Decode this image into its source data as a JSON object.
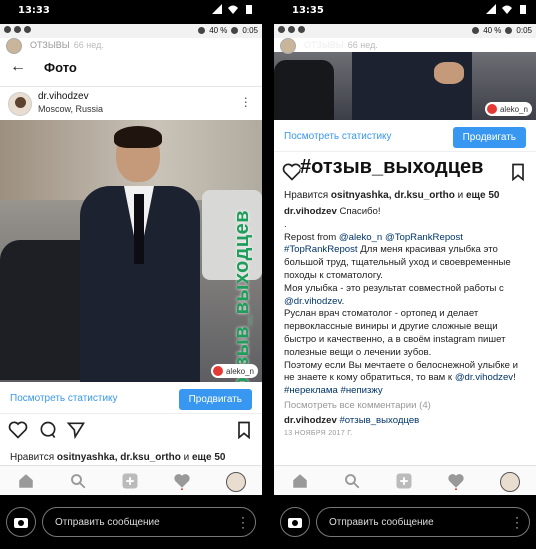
{
  "left": {
    "outer_time": "13:33",
    "inner_status": {
      "battery": "40 %",
      "time": "0:05"
    },
    "story": {
      "name": "ОТЗЫВЫ",
      "time": "66 нед."
    },
    "topbar_title": "Фото",
    "post": {
      "username": "dr.vihodzev",
      "location": "Moscow, Russia",
      "overlay_hashtag": "#отзыв_выходцев",
      "watermark": "aleko_n"
    },
    "stats_link": "Посмотреть статистику",
    "promote_button": "Продвигать",
    "likes": {
      "prefix": "Нравится ",
      "users": "ositnyashka, dr.ksu_ortho",
      "mid": " и ",
      "more": "еще 50"
    },
    "message_placeholder": "Отправить сообщение"
  },
  "right": {
    "outer_time": "13:35",
    "inner_status": {
      "battery": "40 %",
      "time": "0:05"
    },
    "story": {
      "name": "ОТЗЫВЫ",
      "time": "66 нед."
    },
    "watermark": "aleko_n",
    "stats_link": "Посмотреть статистику",
    "promote_button": "Продвигать",
    "caption_hashtag": "#отзыв_выходцев",
    "likes": {
      "prefix": "Нравится ",
      "users": "ositnyashka, dr.ksu_ortho",
      "mid": " и ",
      "more": "еще 50"
    },
    "caption": {
      "author": "dr.vihodzev",
      "thanks": " Спасибо! ",
      "dot": ".",
      "repost_prefix": "Repost from ",
      "repost_user1": "@aleko_n",
      "repost_user2": "@TopRankRepost",
      "repost_tag": "#TopRankRepost",
      "text1": " Для меня красивая улыбка это большой труд, тщательный уход и своевременные походы к стоматологу.",
      "text2": "Моя улыбка - это результат совместной работы с ",
      "mention": "@dr.vihodzev",
      "text2_end": ".",
      "text3": "Руслан врач стоматолог - ортопед и делает первоклассные виниры и другие сложные вещи быстро и качественно, а в своём instagram пишет полезные вещи о лечении зубов.",
      "text4": "Поэтому если Вы мечтаете о белоснежной улыбке и не знаете к кому обратиться, то вам к ",
      "mention2": "@dr.vihodzev",
      "text4_end": "! ",
      "tag1": "#нереклама",
      "tag2": "#непизжу",
      "view_comments": "Посмотреть все комментарии (4)",
      "comment_author": "dr.vihodzev",
      "comment_tag": "#отзыв_выходцев",
      "date": "13 НОЯБРЯ 2017 Г."
    },
    "message_placeholder": "Отправить сообщение"
  },
  "colors": {
    "accent": "#3897f0",
    "hashtag_green": "#1f9d5b",
    "link": "#003569"
  }
}
